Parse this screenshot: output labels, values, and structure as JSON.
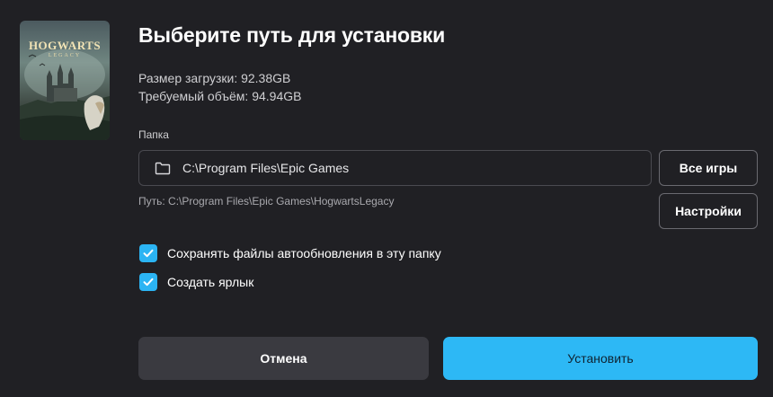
{
  "game": {
    "cover_title": "HOGWARTS",
    "cover_subtitle": "LEGACY"
  },
  "dialog": {
    "title": "Выберите путь для установки",
    "download_size": "Размер загрузки: 92.38GB",
    "required_space": "Требуемый объём: 94.94GB"
  },
  "folder": {
    "label": "Папка",
    "value": "C:\\Program Files\\Epic Games",
    "path": "Путь: C:\\Program Files\\Epic Games\\HogwartsLegacy",
    "icon": "folder-icon"
  },
  "buttons": {
    "all_games": "Все игры",
    "settings": "Настройки",
    "cancel": "Отмена",
    "install": "Установить"
  },
  "options": [
    {
      "label": "Сохранять файлы автообновления в эту папку",
      "checked": true
    },
    {
      "label": "Создать ярлык",
      "checked": true
    }
  ],
  "colors": {
    "background": "#202024",
    "accent": "#2db8f5",
    "secondary_button": "#3a3a40"
  }
}
